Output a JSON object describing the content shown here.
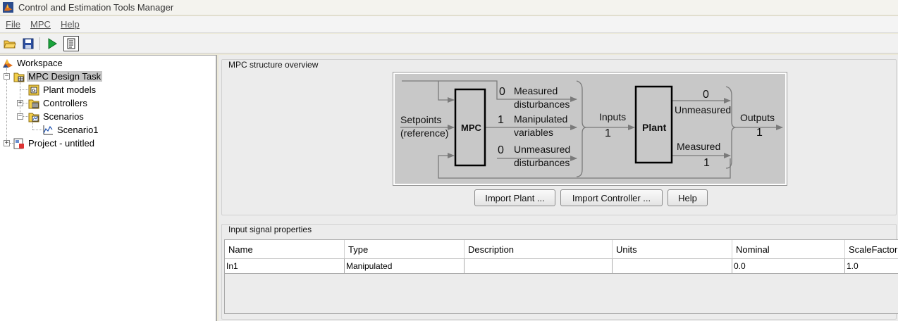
{
  "window": {
    "title": "Control and Estimation Tools Manager",
    "app_icon": "matlab-logo-icon"
  },
  "menu": {
    "items": [
      {
        "label": "File"
      },
      {
        "label": "MPC"
      },
      {
        "label": "Help"
      }
    ]
  },
  "toolbar": {
    "buttons": [
      {
        "icon": "open-folder-icon"
      },
      {
        "icon": "save-disk-icon"
      },
      {
        "icon": "play-run-icon"
      },
      {
        "icon": "notepad-document-icon"
      }
    ]
  },
  "tree": {
    "nodes": [
      {
        "label": "Workspace",
        "icon": "matlab-workspace-icon"
      },
      {
        "label": "MPC Design Task",
        "icon": "mpc-task-folder-icon",
        "selected": true
      },
      {
        "label": "Plant models",
        "icon": "plant-models-icon"
      },
      {
        "label": "Controllers",
        "icon": "controllers-icon"
      },
      {
        "label": "Scenarios",
        "icon": "scenarios-folder-icon"
      },
      {
        "label": "Scenario1",
        "icon": "scenario-plot-icon"
      },
      {
        "label": "Project - untitled",
        "icon": "project-icon"
      }
    ]
  },
  "overview": {
    "title": "MPC structure overview",
    "diagram": {
      "setpoints_line1": "Setpoints",
      "setpoints_line2": "(reference)",
      "mpc_block": "MPC",
      "measured_dist_count": "0",
      "measured_dist_line1": "Measured",
      "measured_dist_line2": "disturbances",
      "manipulated_count": "1",
      "manipulated_line1": "Manipulated",
      "manipulated_line2": "variables",
      "unmeasured_dist_count": "0",
      "unmeasured_dist_line1": "Unmeasured",
      "unmeasured_dist_line2": "disturbances",
      "inputs_label": "Inputs",
      "inputs_count": "1",
      "plant_block": "Plant",
      "unmeasured_out_count": "0",
      "unmeasured_out_label": "Unmeasured",
      "measured_out_label": "Measured",
      "measured_out_count": "1",
      "outputs_label": "Outputs",
      "outputs_count": "1"
    },
    "buttons": {
      "import_plant": "Import Plant ...",
      "import_controller": "Import Controller ...",
      "help": "Help"
    }
  },
  "input_signals": {
    "title": "Input signal properties",
    "columns": [
      "Name",
      "Type",
      "Description",
      "Units",
      "Nominal",
      "ScaleFactor"
    ],
    "rows": [
      [
        "In1",
        "Manipulated",
        "",
        "",
        "0.0",
        "1.0"
      ]
    ]
  }
}
